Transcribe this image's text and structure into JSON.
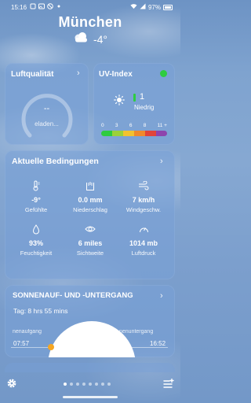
{
  "status_bar": {
    "time": "15:16",
    "battery": "97%"
  },
  "location": {
    "city": "München",
    "temperature": "-4°",
    "condition_icon": "cloudy-icon"
  },
  "air_quality": {
    "title": "Luftqualität",
    "value": "--",
    "status": "eladen..."
  },
  "uv_index": {
    "title": "UV-Index",
    "value": "1",
    "level": "Niedrig",
    "scale_labels": [
      "0",
      "3",
      "6",
      "8",
      "11 +"
    ],
    "scale_colors": [
      "#2ecc40",
      "#9bd13a",
      "#f2c230",
      "#f08a2c",
      "#e0453a",
      "#8e44ad"
    ]
  },
  "conditions": {
    "title": "Aktuelle Bedingungen",
    "items": [
      {
        "value": "-9°",
        "label": "Gefühlte",
        "icon": "thermometer-icon"
      },
      {
        "value": "0.0 mm",
        "label": "Niederschlag",
        "icon": "precipitation-icon"
      },
      {
        "value": "7 km/h",
        "label": "Windgeschw.",
        "icon": "wind-icon"
      },
      {
        "value": "93%",
        "label": "Feuchtigkeit",
        "icon": "humidity-icon"
      },
      {
        "value": "6 miles",
        "label": "Sichtweite",
        "icon": "visibility-icon"
      },
      {
        "value": "1014 mb",
        "label": "Luftdruck",
        "icon": "pressure-icon"
      }
    ]
  },
  "sun": {
    "title": "SONNENAUF- UND -UNTERGANG",
    "day_length": "Tag: 8 hrs 55 mins",
    "sunrise_label": "nenaufgang",
    "sunset_label": "nenuntergang",
    "sunrise_time": "07:57",
    "sunset_time": "16:52"
  },
  "pager": {
    "pages": 8,
    "active": 0
  }
}
